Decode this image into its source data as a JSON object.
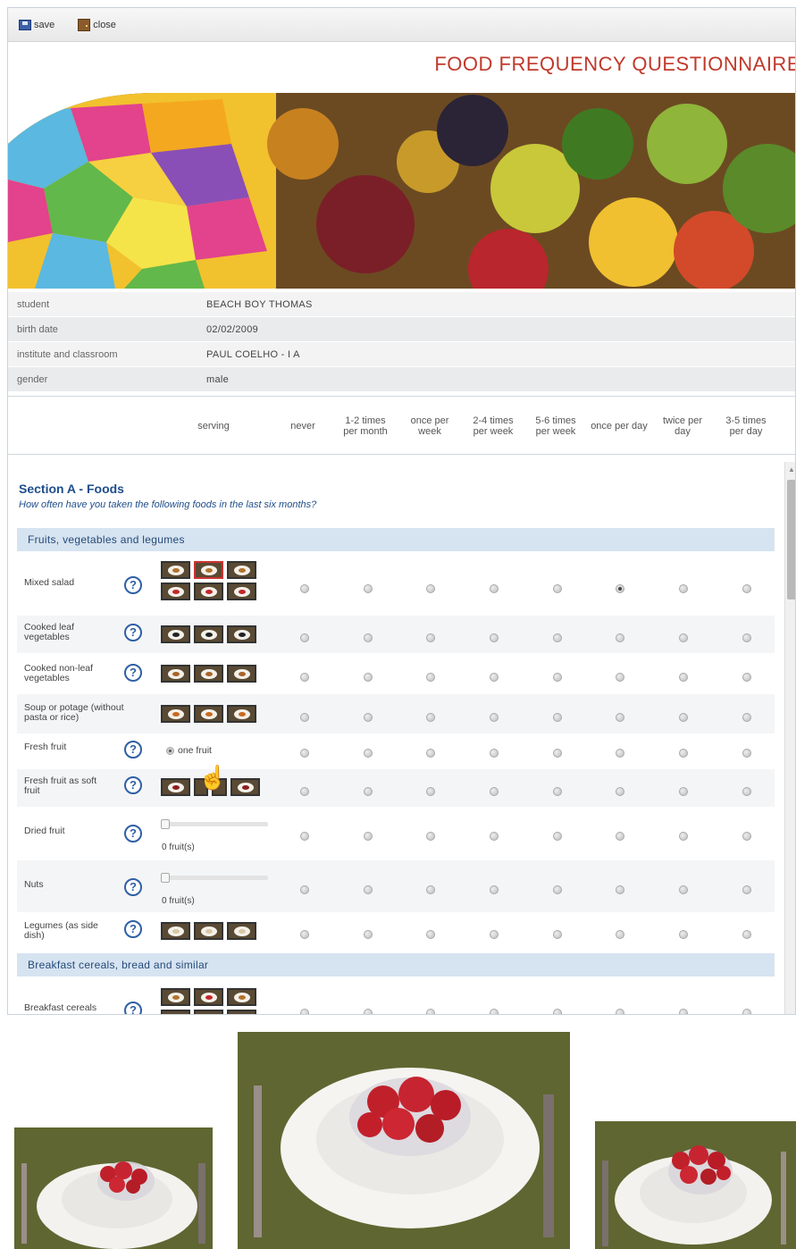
{
  "toolbar": {
    "save_label": "save",
    "close_label": "close"
  },
  "page_title": "FOOD FREQUENCY QUESTIONNAIRE",
  "student_info": [
    {
      "key": "student",
      "value": "BEACH BOY THOMAS"
    },
    {
      "key": "birth date",
      "value": "02/02/2009"
    },
    {
      "key": "institute and classroom",
      "value": "PAUL COELHO - I A"
    },
    {
      "key": "gender",
      "value": "male"
    }
  ],
  "columns": {
    "serving": "serving",
    "never": "never",
    "c1": "1-2 times per month",
    "c2": "once per week",
    "c3": "2-4 times per week",
    "c4": "5-6 times per week",
    "c5": "once per day",
    "c6": "twice per day",
    "c7": "3-5 times per day"
  },
  "section": {
    "title": "Section A - Foods",
    "subtitle": "How often have you taken the following foods in the last six months?"
  },
  "groups": [
    {
      "label": "Fruits, vegetables and legumes"
    },
    {
      "label": "Breakfast cereals, bread and similar"
    }
  ],
  "foods": [
    {
      "name": "Mixed salad",
      "help": "?",
      "serving_type": "images",
      "selected_frequency": 5
    },
    {
      "name": "Cooked leaf vegetables",
      "help": "?",
      "serving_type": "images",
      "selected_frequency": null
    },
    {
      "name": "Cooked non-leaf vegetables",
      "help": "?",
      "serving_type": "images",
      "selected_frequency": null
    },
    {
      "name": "Soup or potage (without pasta or rice)",
      "help": "?",
      "serving_type": "images",
      "selected_frequency": null
    },
    {
      "name": "Fresh fruit",
      "help": "?",
      "serving_type": "radio",
      "serving_option": "one fruit",
      "selected_frequency": null
    },
    {
      "name": "Fresh fruit as soft fruit",
      "help": "?",
      "serving_type": "images",
      "selected_frequency": null
    },
    {
      "name": "Dried fruit",
      "help": "?",
      "serving_type": "slider",
      "slider_value": 0,
      "slider_label": "0 fruit(s)",
      "selected_frequency": null
    },
    {
      "name": "Nuts",
      "help": "?",
      "serving_type": "slider",
      "slider_value": 0,
      "slider_label": "0 fruit(s)",
      "selected_frequency": null
    },
    {
      "name": "Legumes (as side dish)",
      "help": "?",
      "serving_type": "images",
      "selected_frequency": null
    },
    {
      "name": "Breakfast cereals",
      "help": "?",
      "serving_type": "images",
      "selected_frequency": null
    }
  ],
  "icons": {
    "save": "floppy-disk-icon",
    "close": "door-icon",
    "help": "question-mark-icon",
    "cursor": "hand-pointer-icon"
  },
  "colors": {
    "title": "#c0392b",
    "section": "#1f4e8c",
    "group_header_bg": "#d6e3f1"
  }
}
